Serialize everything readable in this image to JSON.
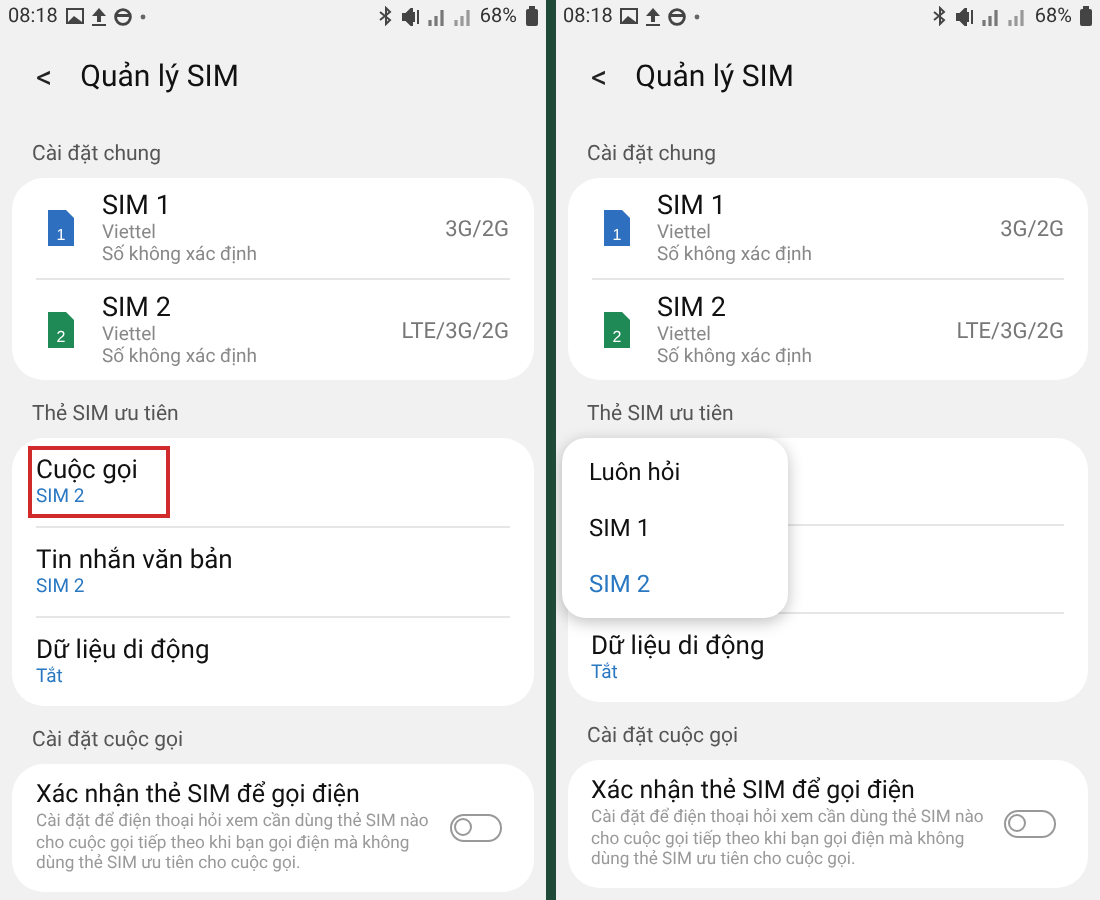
{
  "screens": [
    {
      "status_bar": {
        "time": "08:18",
        "battery": "68%"
      },
      "title": "Quản lý SIM",
      "back": "<",
      "sections": [
        {
          "kind": "sims",
          "label": "Cài đặt chung",
          "items": [
            {
              "name": "SIM 1",
              "number": "1",
              "color": "#2f6fc0",
              "carrier": "Viettel",
              "detail": "Số không xác định",
              "network": "3G/2G"
            },
            {
              "name": "SIM 2",
              "number": "2",
              "color": "#1f8a55",
              "carrier": "Viettel",
              "detail": "Số không xác định",
              "network": "LTE/3G/2G"
            }
          ]
        },
        {
          "kind": "prefs",
          "label": "Thẻ SIM ưu tiên",
          "items": [
            {
              "title": "Cuộc gọi",
              "value": "SIM 2",
              "highlighted": true
            },
            {
              "title": "Tin nhắn văn bản",
              "value": "SIM 2",
              "highlighted": false
            },
            {
              "title": "Dữ liệu di động",
              "value": "Tắt",
              "highlighted": false
            }
          ]
        },
        {
          "kind": "toggles",
          "label": "Cài đặt cuộc gọi",
          "items": [
            {
              "title": "Xác nhận thẻ SIM để gọi điện",
              "description": "Cài đặt để điện thoại hỏi xem cần dùng thẻ SIM nào cho cuộc gọi tiếp theo khi bạn gọi điện mà không dùng thẻ SIM ưu tiên cho cuộc gọi.",
              "on": false
            }
          ]
        }
      ]
    },
    {
      "status_bar": {
        "time": "08:18",
        "battery": "68%"
      },
      "title": "Quản lý SIM",
      "back": "<",
      "sections": [
        {
          "kind": "sims",
          "label": "Cài đặt chung",
          "items": [
            {
              "name": "SIM 1",
              "number": "1",
              "color": "#2f6fc0",
              "carrier": "Viettel",
              "detail": "Số không xác định",
              "network": "3G/2G"
            },
            {
              "name": "SIM 2",
              "number": "2",
              "color": "#1f8a55",
              "carrier": "Viettel",
              "detail": "Số không xác định",
              "network": "LTE/3G/2G"
            }
          ]
        },
        {
          "kind": "prefs",
          "label": "Thẻ SIM ưu tiên",
          "items": [
            {
              "title": "Dữ liệu di động",
              "value": "Tắt",
              "highlighted": false
            }
          ],
          "popup": {
            "options": [
              {
                "label": "Luôn hỏi",
                "selected": false
              },
              {
                "label": "SIM 1",
                "selected": false
              },
              {
                "label": "SIM 2",
                "selected": true
              }
            ]
          }
        },
        {
          "kind": "toggles",
          "label": "Cài đặt cuộc gọi",
          "items": [
            {
              "title": "Xác nhận thẻ SIM để gọi điện",
              "description": "Cài đặt để điện thoại hỏi xem cần dùng thẻ SIM nào cho cuộc gọi tiếp theo khi bạn gọi điện mà không dùng thẻ SIM ưu tiên cho cuộc gọi.",
              "on": false
            }
          ]
        }
      ]
    }
  ]
}
